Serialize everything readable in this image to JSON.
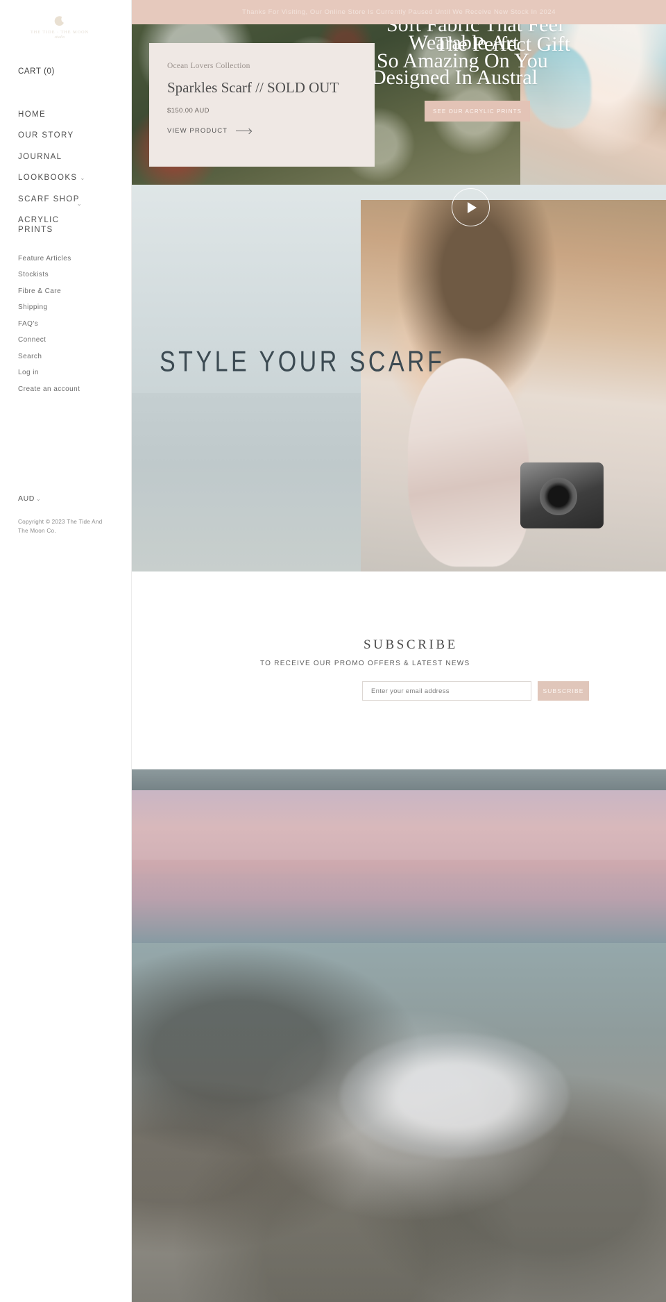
{
  "sidebar": {
    "logo": {
      "icon": "crescent-moon-icon",
      "wordmark": "THE TIDE · THE MOON",
      "script": "studio"
    },
    "cart_label": "CART (0)",
    "main_nav": [
      {
        "label": "HOME",
        "has_caret": false
      },
      {
        "label": "OUR STORY",
        "has_caret": false
      },
      {
        "label": "JOURNAL",
        "has_caret": false
      },
      {
        "label": "LOOKBOOKS",
        "has_caret": true
      },
      {
        "label": "SCARF SHOP",
        "has_caret": true
      },
      {
        "label": "ACRYLIC PRINTS",
        "has_caret": false
      }
    ],
    "secondary_nav": [
      {
        "label": "Feature Articles"
      },
      {
        "label": "Stockists"
      },
      {
        "label": "Fibre & Care"
      },
      {
        "label": "Shipping"
      },
      {
        "label": "FAQ's"
      },
      {
        "label": "Connect"
      },
      {
        "label": "Search"
      },
      {
        "label": "Log in"
      },
      {
        "label": "Create an account"
      }
    ],
    "currency": "AUD",
    "caret_glyph": "⌄",
    "copyright": "Copyright © 2023 The Tide And The Moon Co."
  },
  "announcement": {
    "text": "Thanks For Visiting, Our Online Store Is Currently Paused Until We Receive New Stock In 2024"
  },
  "hero": {
    "headings": [
      "Soft Fabric That Feel",
      "Wearable Art",
      "The Perfect Gift",
      "So Amazing On You",
      "Designed In Austral"
    ],
    "cta_label": "SEE OUR ACRYLIC PRINTS",
    "product_card": {
      "collection": "Ocean Lovers Collection",
      "title": "Sparkles Scarf // SOLD OUT",
      "price": "$150.00 AUD",
      "cta_label": "VIEW PRODUCT"
    }
  },
  "video": {
    "caption": "STYLE YOUR SCARF",
    "play_icon": "play-icon"
  },
  "subscribe": {
    "title": "SUBSCRIBE",
    "subtitle": "TO RECEIVE OUR PROMO OFFERS & LATEST NEWS",
    "input_placeholder": "Enter your email address",
    "input_value": "",
    "button_label": "SUBSCRIBE"
  },
  "colors": {
    "accent_pink": "#e6c9bd",
    "button_pink": "#e0c6ba",
    "card_bg": "#efe8e4",
    "text_dark": "#4a4a4a"
  }
}
